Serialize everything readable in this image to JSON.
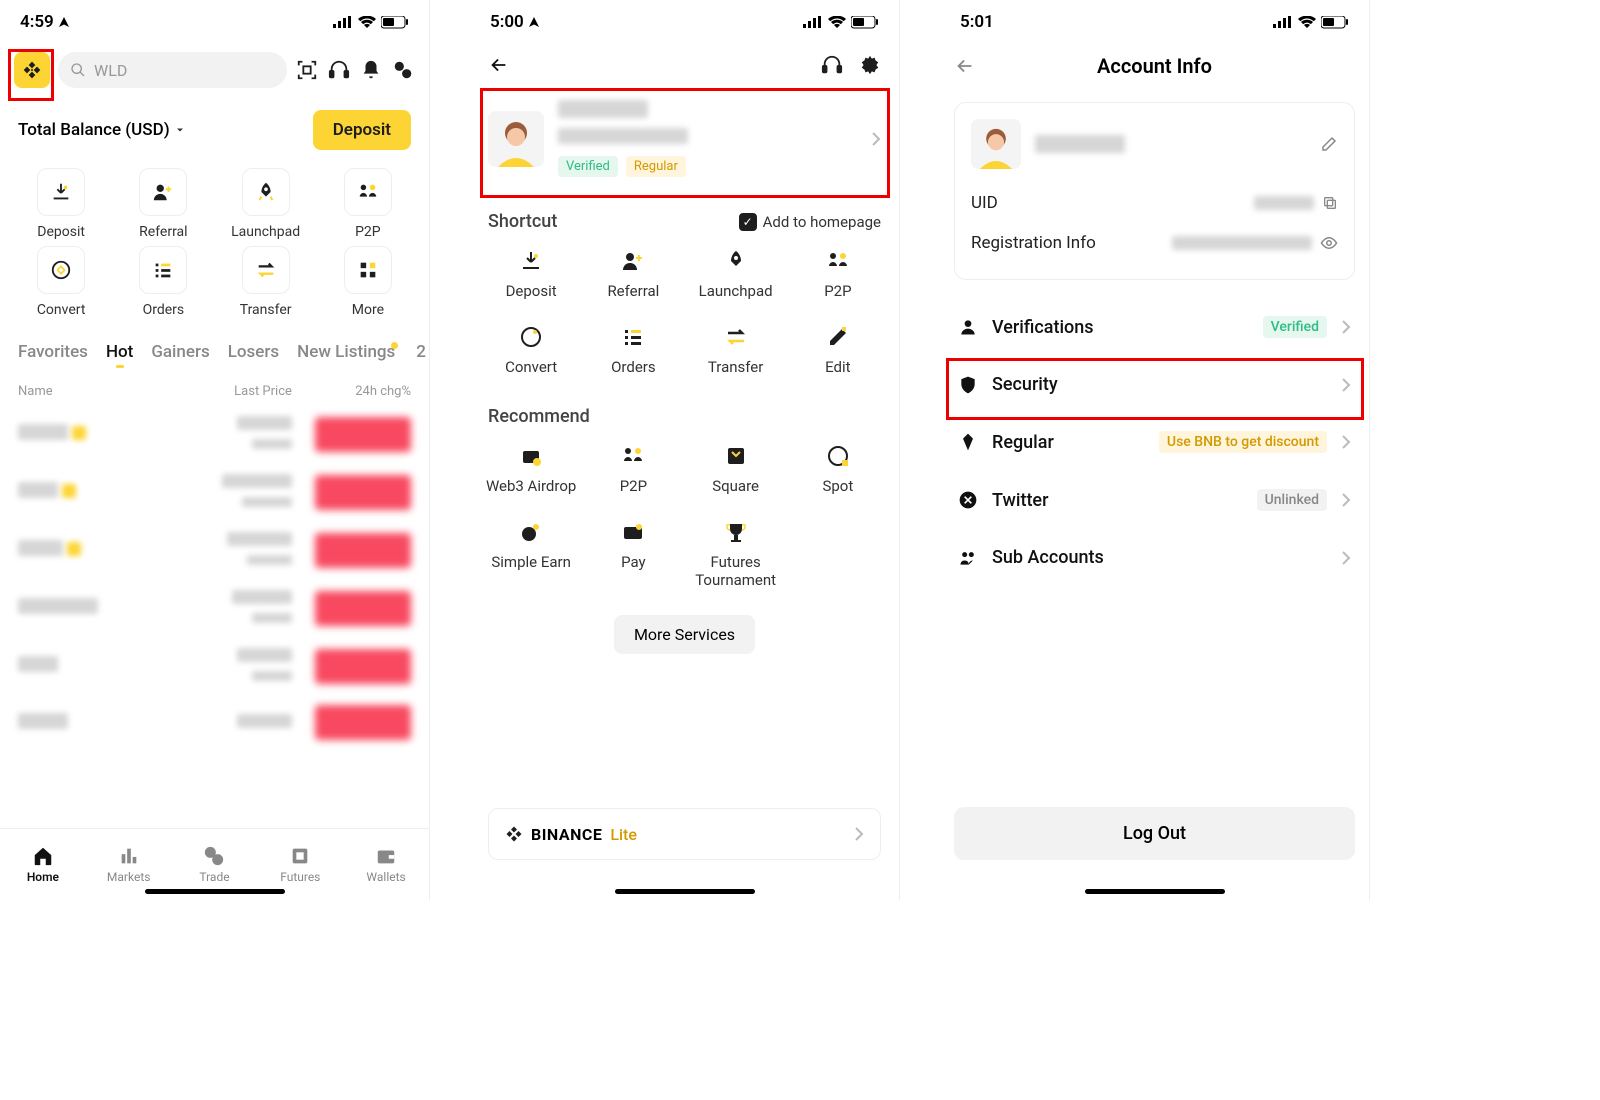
{
  "screen1": {
    "time": "4:59",
    "search_placeholder": "WLD",
    "balance_label": "Total Balance (USD)",
    "deposit_button": "Deposit",
    "shortcuts": [
      "Deposit",
      "Referral",
      "Launchpad",
      "P2P",
      "Convert",
      "Orders",
      "Transfer",
      "More"
    ],
    "tabs": [
      "Favorites",
      "Hot",
      "Gainers",
      "Losers",
      "New Listings",
      "2"
    ],
    "active_tab": "Hot",
    "list_headers": [
      "Name",
      "Last Price",
      "24h chg%"
    ],
    "tabbar": [
      "Home",
      "Markets",
      "Trade",
      "Futures",
      "Wallets"
    ],
    "active_nav": "Home"
  },
  "screen2": {
    "time": "5:00",
    "badges": [
      "Verified",
      "Regular"
    ],
    "shortcut_title": "Shortcut",
    "add_home": "Add to homepage",
    "shortcuts": [
      "Deposit",
      "Referral",
      "Launchpad",
      "P2P",
      "Convert",
      "Orders",
      "Transfer",
      "Edit"
    ],
    "recommend_title": "Recommend",
    "recommends": [
      "Web3 Airdrop",
      "P2P",
      "Square",
      "Spot",
      "Simple Earn",
      "Pay",
      "Futures Tournament"
    ],
    "more_services": "More Services",
    "lite_brand": "BINANCE",
    "lite_word": "Lite"
  },
  "screen3": {
    "time": "5:01",
    "title": "Account Info",
    "uid_label": "UID",
    "reg_label": "Registration Info",
    "menu": {
      "verifications": "Verifications",
      "verifications_badge": "Verified",
      "security": "Security",
      "regular": "Regular",
      "regular_badge": "Use BNB to get discount",
      "twitter": "Twitter",
      "twitter_badge": "Unlinked",
      "sub": "Sub Accounts"
    },
    "logout": "Log Out"
  }
}
